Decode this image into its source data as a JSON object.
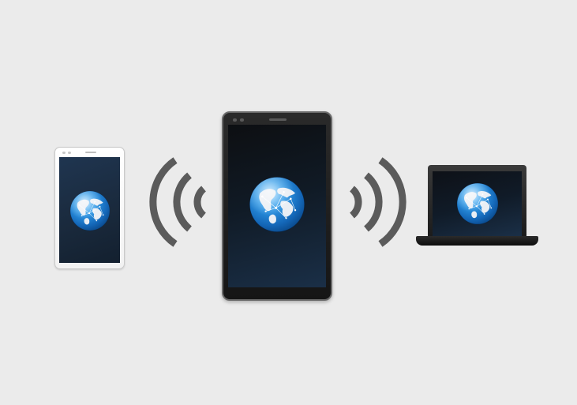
{
  "scene": {
    "background": "#ebebeb",
    "devices": [
      {
        "kind": "white-smartphone",
        "screen_icon": "globe-icon"
      },
      {
        "kind": "black-smartphone",
        "screen_icon": "globe-icon"
      },
      {
        "kind": "laptop",
        "screen_icon": "globe-icon"
      }
    ],
    "signal_icons": [
      "wireless-waves-left-icon",
      "wireless-waves-right-icon"
    ],
    "colors": {
      "globe_blue": "#2c8fe0",
      "globe_land": "#e8eef4",
      "wave_gray": "#5b5b5b",
      "screen_dark": "#15263a"
    }
  }
}
